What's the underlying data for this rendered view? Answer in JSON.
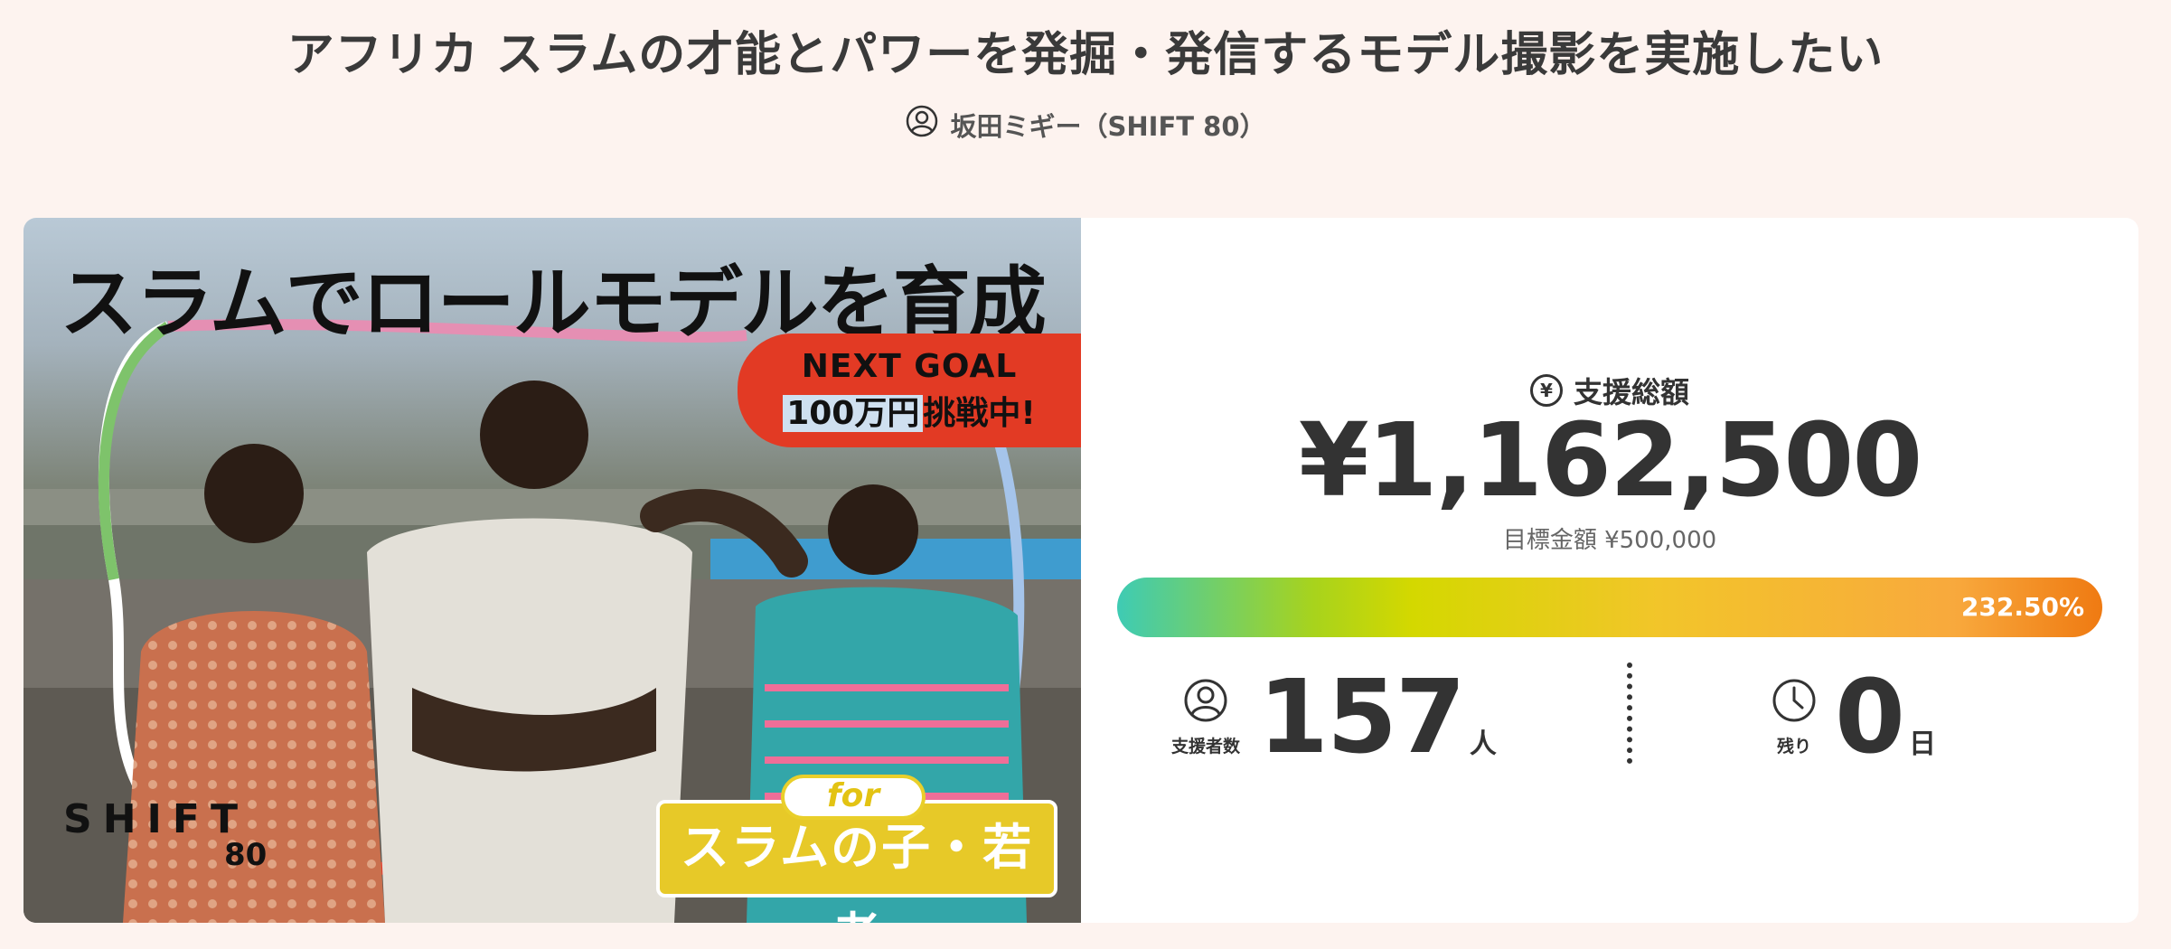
{
  "page": {
    "title": "アフリカ スラムの才能とパワーを発掘・発信するモデル撮影を実施したい",
    "owner": "坂田ミギー（SHIFT 80）"
  },
  "hero": {
    "headline": "スラムでロールモデルを育成",
    "goal_line1": "NEXT GOAL",
    "goal_amount": "100万円",
    "goal_suffix": "挑戦中!",
    "for_label": "for",
    "for_text": "スラムの子・若者",
    "logo_line1": "SHIFT",
    "logo_line2": "80"
  },
  "stats": {
    "total_label": "支援総額",
    "yen_symbol": "¥",
    "total_amount": "¥1,162,500",
    "target": "目標金額 ¥500,000",
    "progress_text": "232.50%",
    "progress_fraction": 1.0,
    "supporters_label": "支援者数",
    "supporters": "157",
    "supporters_unit": "人",
    "remaining_label": "残り",
    "remaining": "0",
    "remaining_unit": "日"
  },
  "colors": {
    "background": "#fdf3ef",
    "goal_badge": "#e23a24",
    "for_box": "#e7c928"
  }
}
